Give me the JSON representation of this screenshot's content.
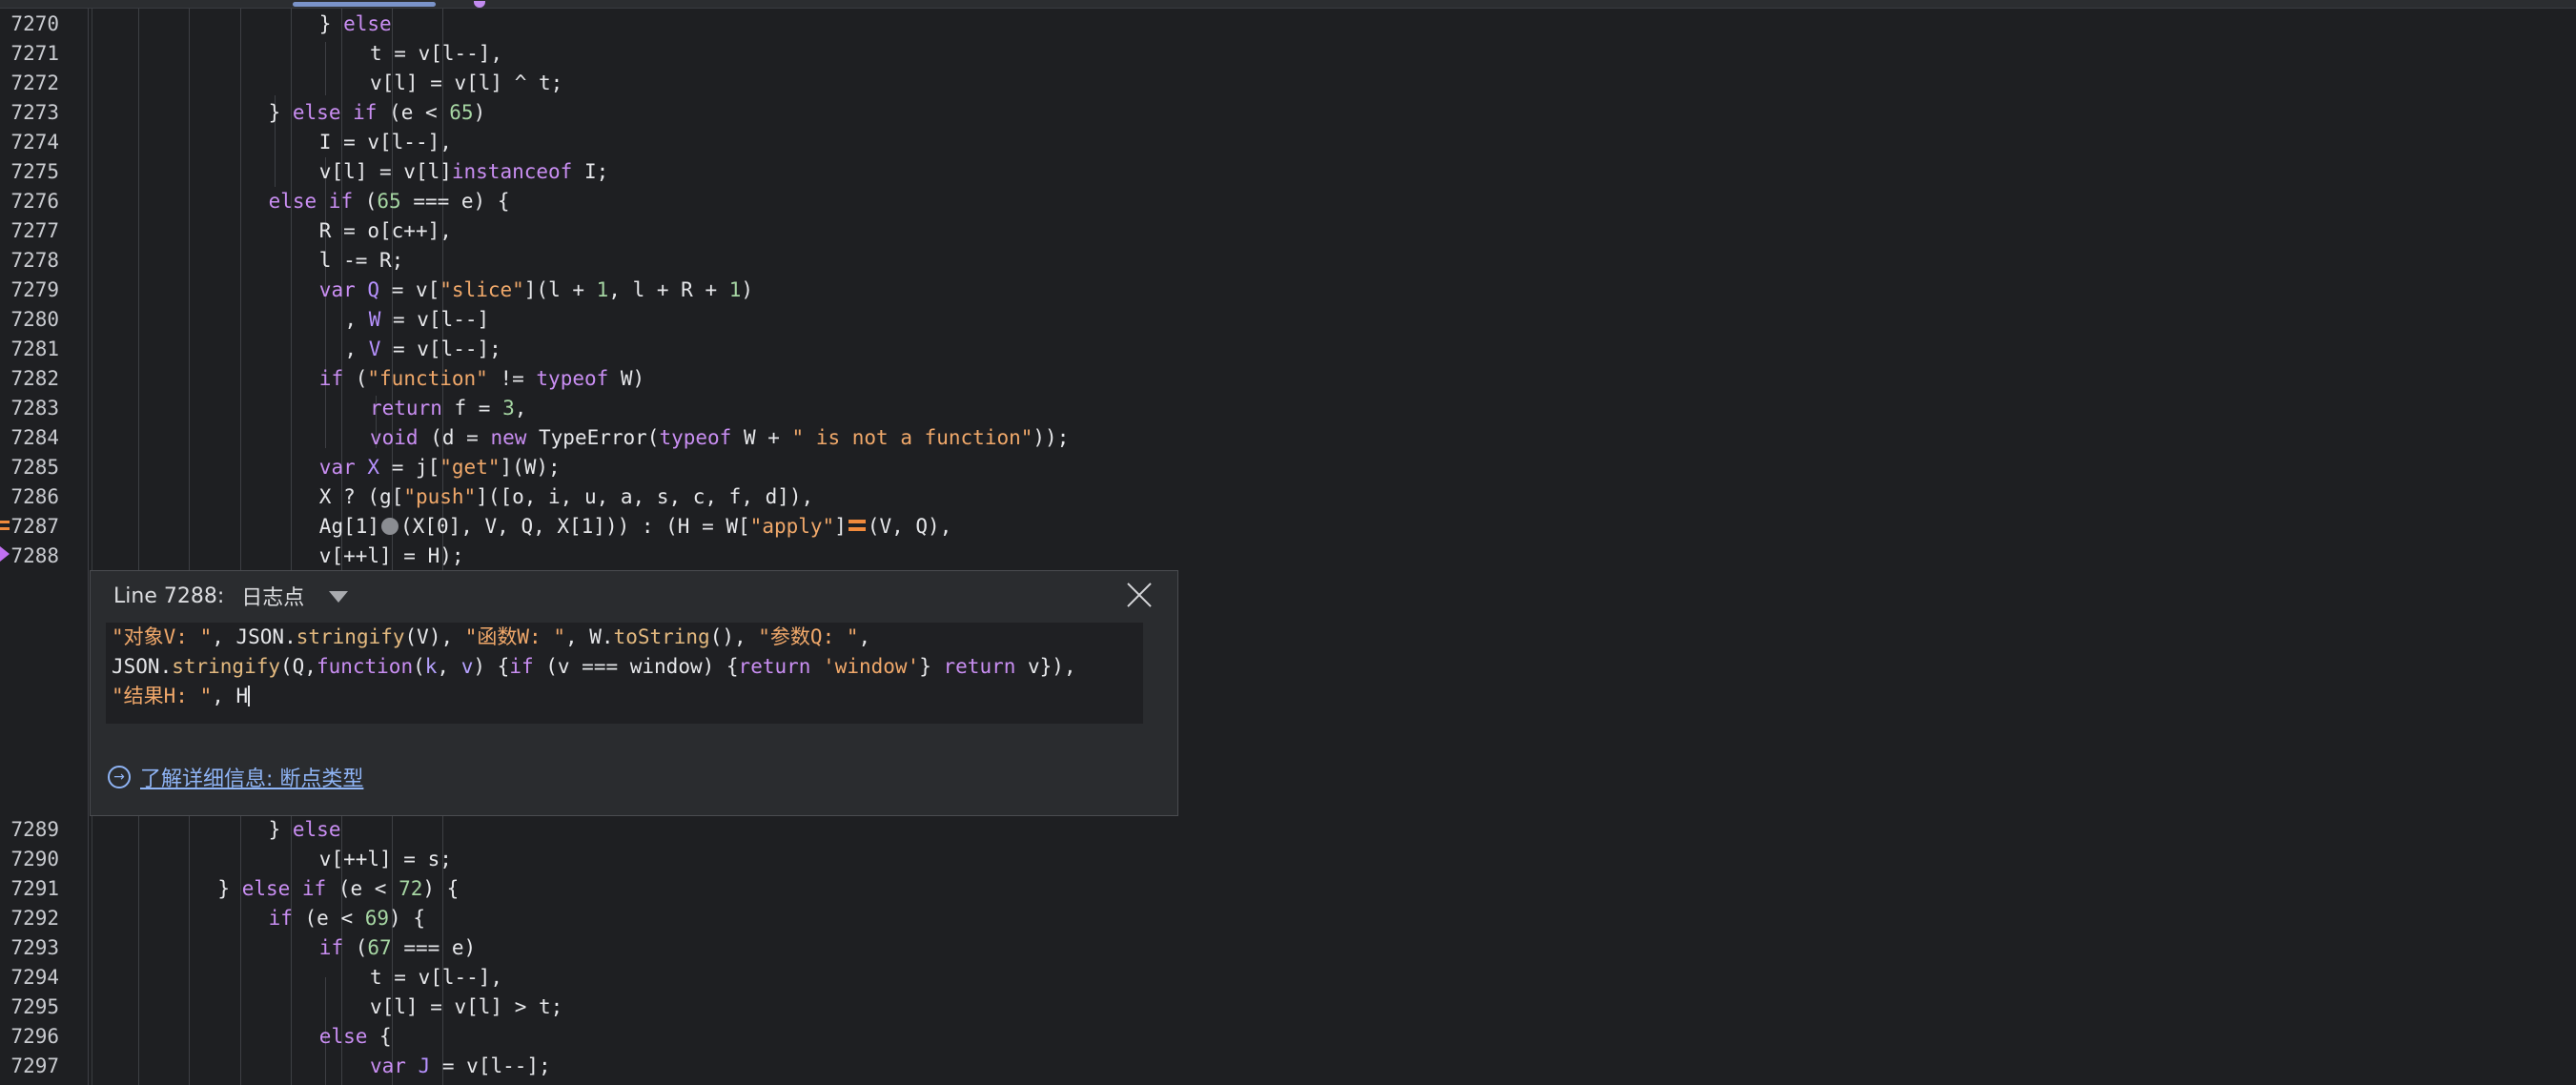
{
  "editor": {
    "lines_top": [
      {
        "n": "7270",
        "indent": 16,
        "tokens": [
          [
            "t",
            "} "
          ],
          [
            "kw",
            "else"
          ]
        ]
      },
      {
        "n": "7271",
        "indent": 20,
        "tokens": [
          [
            "t",
            "t = v[l--],"
          ]
        ]
      },
      {
        "n": "7272",
        "indent": 20,
        "tokens": [
          [
            "t",
            "v[l] = v[l] ^ t;"
          ]
        ]
      },
      {
        "n": "7273",
        "indent": 12,
        "tokens": [
          [
            "t",
            "} "
          ],
          [
            "kw",
            "else if"
          ],
          [
            "t",
            " (e < "
          ],
          [
            "num",
            "65"
          ],
          [
            "t",
            ")"
          ]
        ]
      },
      {
        "n": "7274",
        "indent": 16,
        "tokens": [
          [
            "t",
            "I = v[l--],"
          ]
        ]
      },
      {
        "n": "7275",
        "indent": 16,
        "tokens": [
          [
            "t",
            "v[l] = v[l]"
          ],
          [
            "kw",
            "instanceof"
          ],
          [
            "t",
            " I;"
          ]
        ]
      },
      {
        "n": "7276",
        "indent": 12,
        "tokens": [
          [
            "kw",
            "else if"
          ],
          [
            "t",
            " ("
          ],
          [
            "num",
            "65"
          ],
          [
            "t",
            " === e) {"
          ]
        ]
      },
      {
        "n": "7277",
        "indent": 16,
        "tokens": [
          [
            "t",
            "R = o[c++],"
          ]
        ]
      },
      {
        "n": "7278",
        "indent": 16,
        "tokens": [
          [
            "t",
            "l -= R;"
          ]
        ]
      },
      {
        "n": "7279",
        "indent": 16,
        "tokens": [
          [
            "kw",
            "var"
          ],
          [
            "t",
            " "
          ],
          [
            "var",
            "Q"
          ],
          [
            "t",
            " = v["
          ],
          [
            "str",
            "\"slice\""
          ],
          [
            "t",
            "](l + "
          ],
          [
            "num",
            "1"
          ],
          [
            "t",
            ", l + R + "
          ],
          [
            "num",
            "1"
          ],
          [
            "t",
            ")"
          ]
        ]
      },
      {
        "n": "7280",
        "indent": 18,
        "tokens": [
          [
            "t",
            ", "
          ],
          [
            "var",
            "W"
          ],
          [
            "t",
            " = v[l--]"
          ]
        ]
      },
      {
        "n": "7281",
        "indent": 18,
        "tokens": [
          [
            "t",
            ", "
          ],
          [
            "var",
            "V"
          ],
          [
            "t",
            " = v[l--];"
          ]
        ]
      },
      {
        "n": "7282",
        "indent": 16,
        "tokens": [
          [
            "kw",
            "if"
          ],
          [
            "t",
            " ("
          ],
          [
            "str",
            "\"function\""
          ],
          [
            "t",
            " != "
          ],
          [
            "kw",
            "typeof"
          ],
          [
            "t",
            " W)"
          ]
        ]
      },
      {
        "n": "7283",
        "indent": 20,
        "tokens": [
          [
            "kw",
            "return"
          ],
          [
            "t",
            " f = "
          ],
          [
            "num",
            "3"
          ],
          [
            "t",
            ","
          ]
        ]
      },
      {
        "n": "7284",
        "indent": 20,
        "tokens": [
          [
            "kw",
            "void"
          ],
          [
            "t",
            " (d = "
          ],
          [
            "kw",
            "new"
          ],
          [
            "t",
            " TypeError("
          ],
          [
            "kw",
            "typeof"
          ],
          [
            "t",
            " W + "
          ],
          [
            "str",
            "\" is not a function\""
          ],
          [
            "t",
            "));"
          ]
        ]
      },
      {
        "n": "7285",
        "indent": 16,
        "tokens": [
          [
            "kw",
            "var"
          ],
          [
            "t",
            " "
          ],
          [
            "var",
            "X"
          ],
          [
            "t",
            " = j["
          ],
          [
            "str",
            "\"get\""
          ],
          [
            "t",
            "](W);"
          ]
        ]
      },
      {
        "n": "7286",
        "indent": 16,
        "tokens": [
          [
            "t",
            "X ? (g["
          ],
          [
            "str",
            "\"push\""
          ],
          [
            "t",
            "]([o, i, u, a, s, c, f, d]),"
          ]
        ]
      },
      {
        "n": "7287",
        "indent": 16,
        "tokens": [
          [
            "t",
            "Ag[1]"
          ],
          [
            "dot",
            ""
          ],
          [
            "t",
            "(X[0], V, Q, X[1])) : (H = W["
          ],
          [
            "str",
            "\"apply\""
          ],
          [
            "t",
            "]"
          ],
          [
            "eq",
            ""
          ],
          [
            "t",
            "(V, Q),"
          ]
        ]
      },
      {
        "n": "7288",
        "indent": 16,
        "tokens": [
          [
            "t",
            "v[++l] = H);"
          ]
        ]
      }
    ],
    "lines_bottom": [
      {
        "n": "7289",
        "indent": 12,
        "tokens": [
          [
            "t",
            "} "
          ],
          [
            "kw",
            "else"
          ]
        ]
      },
      {
        "n": "7290",
        "indent": 16,
        "tokens": [
          [
            "t",
            "v[++l] = s;"
          ]
        ]
      },
      {
        "n": "7291",
        "indent": 8,
        "tokens": [
          [
            "t",
            "} "
          ],
          [
            "kw",
            "else if"
          ],
          [
            "t",
            " (e < "
          ],
          [
            "num",
            "72"
          ],
          [
            "t",
            ") {"
          ]
        ]
      },
      {
        "n": "7292",
        "indent": 12,
        "tokens": [
          [
            "kw",
            "if"
          ],
          [
            "t",
            " (e < "
          ],
          [
            "num",
            "69"
          ],
          [
            "t",
            ") {"
          ]
        ]
      },
      {
        "n": "7293",
        "indent": 16,
        "tokens": [
          [
            "kw",
            "if"
          ],
          [
            "t",
            " ("
          ],
          [
            "num",
            "67"
          ],
          [
            "t",
            " === e)"
          ]
        ]
      },
      {
        "n": "7294",
        "indent": 20,
        "tokens": [
          [
            "t",
            "t = v[l--],"
          ]
        ]
      },
      {
        "n": "7295",
        "indent": 20,
        "tokens": [
          [
            "t",
            "v[l] = v[l] > t;"
          ]
        ]
      },
      {
        "n": "7296",
        "indent": 16,
        "tokens": [
          [
            "kw",
            "else"
          ],
          [
            "t",
            " {"
          ]
        ]
      },
      {
        "n": "7297",
        "indent": 20,
        "tokens": [
          [
            "kw",
            "var"
          ],
          [
            "t",
            " "
          ],
          [
            "var",
            "J"
          ],
          [
            "t",
            " = v[l--];"
          ]
        ]
      }
    ]
  },
  "logpoint": {
    "line_label": "Line 7288:",
    "type_label": "日志点",
    "code_lines": [
      [
        [
          "str",
          "\"对象V: \""
        ],
        [
          "t",
          ", JSON."
        ],
        [
          "fn",
          "stringify"
        ],
        [
          "t",
          "(V), "
        ],
        [
          "str",
          "\"函数W: \""
        ],
        [
          "t",
          ", W."
        ],
        [
          "fn",
          "toString"
        ],
        [
          "t",
          "(), "
        ],
        [
          "str",
          "\"参数Q: \""
        ],
        [
          "t",
          ","
        ]
      ],
      [
        [
          "t",
          "JSON."
        ],
        [
          "fn",
          "stringify"
        ],
        [
          "t",
          "(Q,"
        ],
        [
          "kw",
          "function"
        ],
        [
          "t",
          "("
        ],
        [
          "meth",
          "k"
        ],
        [
          "t",
          ", "
        ],
        [
          "meth",
          "v"
        ],
        [
          "t",
          ") {"
        ],
        [
          "kw",
          "if"
        ],
        [
          "t",
          " (v === window) {"
        ],
        [
          "kw",
          "return"
        ],
        [
          "t",
          " "
        ],
        [
          "str",
          "'window'"
        ],
        [
          "t",
          "} "
        ],
        [
          "kw",
          "return"
        ],
        [
          "t",
          " v}),"
        ]
      ],
      [
        [
          "str",
          "\"结果H: \""
        ],
        [
          "t",
          ", H"
        ],
        [
          "caret",
          ""
        ]
      ]
    ],
    "learn_more": "了解详细信息: 断点类型"
  }
}
